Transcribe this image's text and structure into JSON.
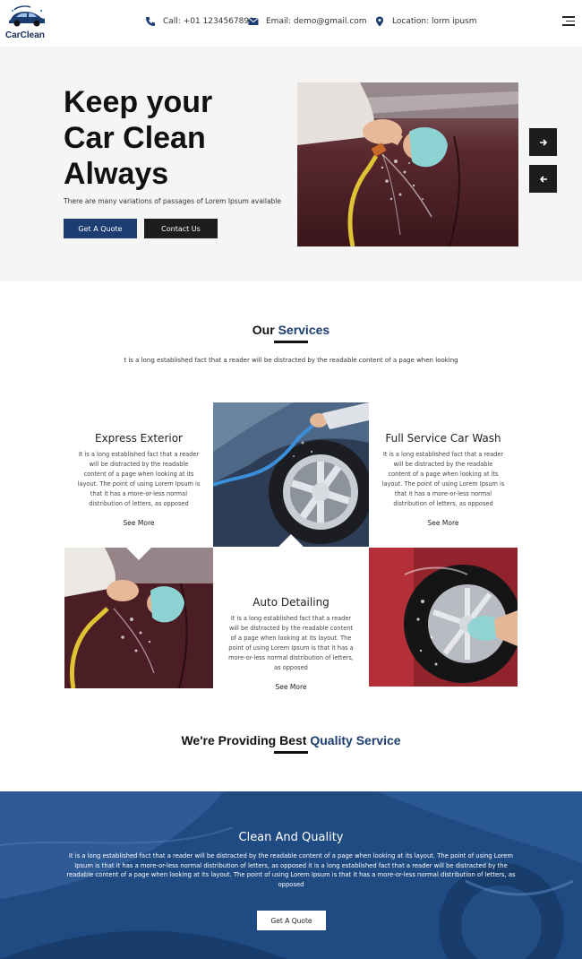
{
  "header": {
    "logo_text": "CarClean",
    "call": "Call: +01 1234567890",
    "email": "Email: demo@gmail.com",
    "location": "Location: lorm ipusm"
  },
  "hero": {
    "title_line1": "Keep your",
    "title_line2": "Car Clean",
    "title_line3": "Always",
    "subtitle": "There are many variations of passages of Lorem Ipsum available",
    "btn_quote": "Get A Quote",
    "btn_contact": "Contact Us",
    "next_icon": "arrow-right-icon",
    "prev_icon": "arrow-left-icon"
  },
  "services": {
    "title_a": "Our ",
    "title_b": "Services",
    "desc": "t is a long established fact that a reader will be distracted by the readable content of a page when looking",
    "items": [
      {
        "title": "Express Exterior",
        "body": "It is a long established fact that a reader will be distracted by the readable content of a page when looking at its layout. The point of using Lorem Ipsum is that it has a more-or-less normal distribution of letters, as opposed",
        "more": "See More"
      },
      {
        "title": "Full Service Car Wash",
        "body": "It is a long established fact that a reader will be distracted by the readable content of a page when looking at its layout. The point of using Lorem Ipsum is that it has a more-or-less normal distribution of letters, as opposed",
        "more": "See More"
      },
      {
        "title": "Auto Detailing",
        "body": "It is a long established fact that a reader will be distracted by the readable content of a page when looking at its layout. The point of using Lorem Ipsum is that it has a more-or-less normal distribution of letters, as opposed",
        "more": "See More"
      }
    ]
  },
  "providing": {
    "title_a": "We're Providing ",
    "title_b": "Best ",
    "title_c": "Quality Service"
  },
  "quality": {
    "title": "Clean And Quality",
    "body": "It is a long established fact that a reader will be distracted by the readable content of a page when looking at its layout. The point of using Lorem Ipsum is that it has a more-or-less normal distribution of letters, as opposed it is a long established fact that a reader will be distracted by the readable content of a page when looking at its layout. The point of using Lorem Ipsum is that it has a more-or-less normal distribution of letters, as opposed",
    "btn": "Get A Quote"
  },
  "colors": {
    "brand_blue": "#1b3d70",
    "dark": "#1d1d1d",
    "hero_bg": "#f5f5f5",
    "quality_bg": "#1f4a80"
  }
}
